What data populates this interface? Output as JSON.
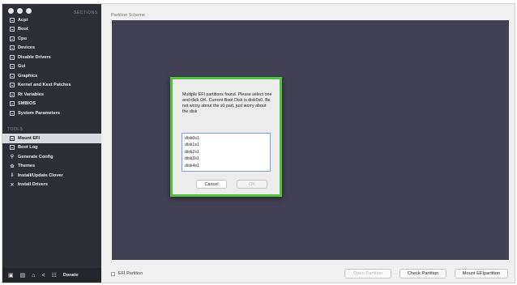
{
  "sidebar": {
    "section_label": "SECTIONS",
    "tools_label": "TOOLS",
    "sections": [
      {
        "label": "Acpi"
      },
      {
        "label": "Boot"
      },
      {
        "label": "Cpu"
      },
      {
        "label": "Devices"
      },
      {
        "label": "Disable Drivers"
      },
      {
        "label": "Gui"
      },
      {
        "label": "Graphics"
      },
      {
        "label": "Kernel and Kext Patches"
      },
      {
        "label": "Rt Variables"
      },
      {
        "label": "SMBIOS"
      },
      {
        "label": "System Parameters"
      }
    ],
    "tools": [
      {
        "label": "Mount EFI",
        "icon": "disk-icon"
      },
      {
        "label": "Boot Log",
        "icon": "document-icon"
      },
      {
        "label": "Generate Config",
        "icon": "magic-wand-icon"
      },
      {
        "label": "Themes",
        "icon": "palette-icon"
      },
      {
        "label": "Install/Update Clover",
        "icon": "download-icon"
      },
      {
        "label": "Install Drivers",
        "icon": "wrench-icon"
      }
    ],
    "dock": {
      "donate_label": "Donate"
    }
  },
  "main": {
    "panel_title": "Partition Scheme",
    "efi_checkbox_label": "EFI Partition",
    "open_partition_label": "Open Partition",
    "check_partition_label": "Check Partition",
    "mount_efi_label": "Mount EFIpartition"
  },
  "dialog": {
    "message": "Multiple EFI partitions found. Please select one and click OK. Current Boot Disk is disk0s0. Be not worry about the s0 part, just worry about the disk",
    "disks": [
      "disk0s1",
      "disk1s1",
      "disk2s1",
      "disk3s1",
      "disk4s1"
    ],
    "cancel_label": "Cancel",
    "ok_label": "OK"
  },
  "colors": {
    "sidebar_bg": "#2d2f36",
    "scheme_bg": "#414153",
    "dialog_highlight": "#52c23f"
  }
}
